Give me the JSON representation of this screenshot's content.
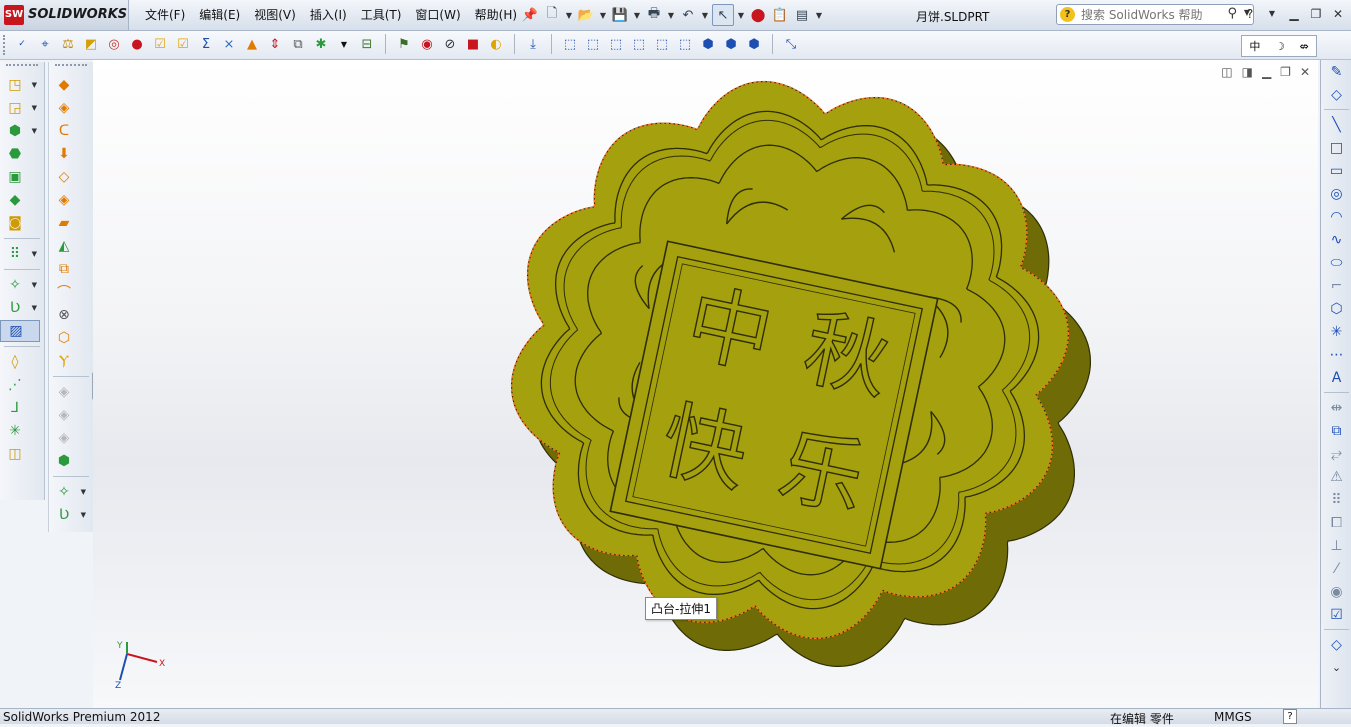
{
  "app": {
    "logo_badge": "SW",
    "logo_text": "SOLIDWORKS"
  },
  "menu": [
    "文件(F)",
    "编辑(E)",
    "视图(V)",
    "插入(I)",
    "工具(T)",
    "窗口(W)",
    "帮助(H)"
  ],
  "document": {
    "title": "月饼.SLDPRT"
  },
  "help_search": {
    "icon_text": "?",
    "placeholder": "搜索 SolidWorks 帮助"
  },
  "ime": {
    "lang": "中",
    "moon": "☽",
    "punct": "⇎"
  },
  "model": {
    "characters": [
      "中",
      "秋",
      "快",
      "乐"
    ],
    "colors": {
      "top": "#a4a00e",
      "side": "#6f6c08",
      "edge": "#2f2d05",
      "highlight": "#f47a1f"
    }
  },
  "tooltip": {
    "text": "凸台-拉伸1"
  },
  "triad": {
    "x": "X",
    "y": "Y",
    "z": "Z"
  },
  "status": {
    "product": "SolidWorks Premium 2012",
    "editing": "在编辑 零件",
    "units": "MMGS",
    "help": "?"
  }
}
